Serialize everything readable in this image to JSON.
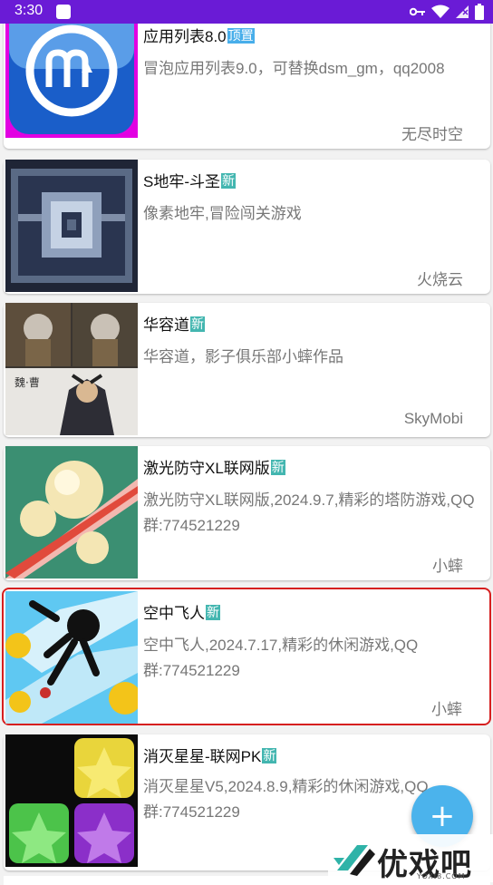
{
  "status_bar": {
    "time": "3:30",
    "icons": [
      "notification-icon",
      "key-icon",
      "wifi-icon",
      "no-sim-icon",
      "battery-icon"
    ]
  },
  "apps": [
    {
      "title": "应用列表8.0",
      "badge": "顶置",
      "badge_type": "pin",
      "desc": "冒泡应用列表9.0，可替换dsm_gm，qq2008",
      "author": "无尽时空"
    },
    {
      "title": "S地牢-斗圣",
      "badge": "新",
      "badge_type": "new",
      "desc": "像素地牢,冒险闯关游戏",
      "author": "火烧云"
    },
    {
      "title": "华容道",
      "badge": "新",
      "badge_type": "new",
      "desc": "华容道，影子俱乐部小蟀作品",
      "author": "SkyMobi"
    },
    {
      "title": "激光防守XL联网版",
      "badge": "新",
      "badge_type": "new",
      "desc": "激光防守XL联网版,2024.9.7,精彩的塔防游戏,QQ群:774521229",
      "author": "小蟀"
    },
    {
      "title": "空中飞人",
      "badge": "新",
      "badge_type": "new",
      "desc": "空中飞人,2024.7.17,精彩的休闲游戏,QQ群:774521229",
      "author": "小蟀"
    },
    {
      "title": "消灭星星-联网PK",
      "badge": "新",
      "badge_type": "new",
      "desc": "消灭星星V5,2024.8.9,精彩的休闲游戏,QQ群:774521229",
      "author": ""
    }
  ],
  "fab": {
    "label": "+"
  },
  "watermark": {
    "text": "优戏吧",
    "url": "YOXI8.COM"
  }
}
